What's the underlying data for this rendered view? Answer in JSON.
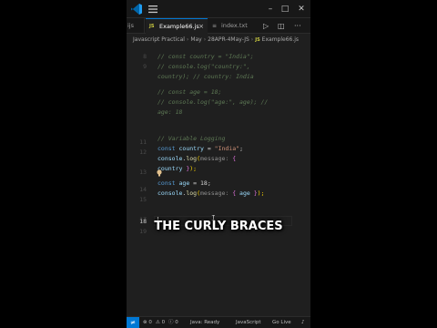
{
  "titlebar": {
    "logo_icon": "vscode-logo-icon",
    "menu_icon": "hamburger-menu-icon",
    "minimize": "–",
    "maximize": "□",
    "close": "✕"
  },
  "tabs": {
    "previous_partial": "ijs",
    "active": {
      "badge": "JS",
      "label": "Example66.js",
      "close": "×"
    },
    "second": {
      "badge": "≡",
      "label": "index.txt"
    },
    "run_icon": "▷",
    "split_icon": "◫",
    "more_icon": "···"
  },
  "breadcrumb": {
    "items": [
      "Javascript Practical",
      "May",
      "28APR-4May-JS"
    ],
    "separator": "›",
    "file_badge": "JS",
    "file": "Example66.js"
  },
  "editor": {
    "line_numbers": [
      "8",
      "9",
      "",
      "",
      "",
      "",
      "",
      "",
      "",
      "11",
      "12",
      "",
      "13",
      "14",
      "15",
      "",
      "17",
      "18",
      "19",
      "",
      "",
      "",
      "",
      ""
    ],
    "active_line": "18",
    "lines": {
      "l1": "// const country = \"India\";",
      "l2": "// console.log(\"country:\",",
      "l3": "country); // country: India",
      "l4": "// const age = 18;",
      "l5": "// console.log(\"age:\", age); //",
      "l6": "age: 18",
      "l7": "// Variable Logging",
      "l8_kw": "const",
      "l8_var": "country",
      "l8_op": " = ",
      "l8_str": "\"India\"",
      "l8_end": ";",
      "l9_obj": "console",
      "l9_dot": ".",
      "l9_fn": "log",
      "l9_open": "(",
      "l9_hint": "message:",
      "l9_brace": " {",
      "l10_var": "country",
      "l10_close_brace": " }",
      "l10_close": ");",
      "l11_kw": "const",
      "l11_var": "age",
      "l11_rest": " = 18;",
      "l12_obj": "console",
      "l12_dot": ".",
      "l12_fn": "log",
      "l12_open": "(",
      "l12_hint": "message:",
      "l12_brace_open": " {",
      "l12_var": " age",
      "l12_brace_close": " }",
      "l12_close": ");"
    }
  },
  "overlay": {
    "caption": "THE CURLY BRACES"
  },
  "statusbar": {
    "remote_icon": "≠",
    "errors": "⊗ 0",
    "warnings": "⚠ 0",
    "info": "ⓘ 0",
    "mode": "Java: Ready",
    "language": "JavaScript",
    "go_live": "Go Live",
    "bell_icon": "♪"
  },
  "colors": {
    "accent": "#0078d4",
    "editor_bg": "#1f1f1f",
    "chrome_bg": "#181818"
  }
}
